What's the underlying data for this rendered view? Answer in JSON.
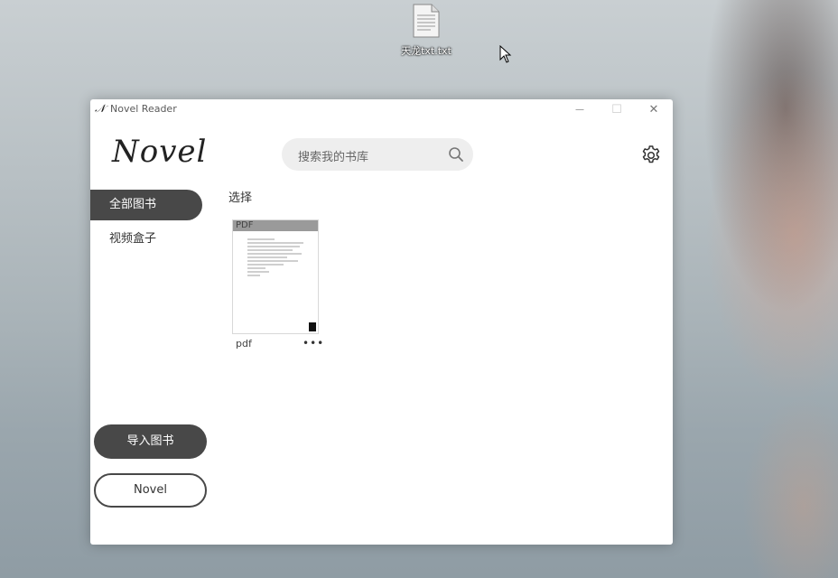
{
  "desktop": {
    "file_label": "天龙txt.txt",
    "file_icon": "text-file-icon",
    "cursor_icon": "arrow-cursor-icon"
  },
  "window": {
    "title": "Novel Reader",
    "app_icon_glyph": "𝒩",
    "minimize_glyph": "—",
    "maximize_glyph": "☐",
    "close_glyph": "✕"
  },
  "header": {
    "logo": "Novel",
    "search_placeholder": "搜索我的书库",
    "settings_icon": "gear-icon"
  },
  "sidebar": {
    "items": [
      {
        "label": "全部图书",
        "active": true
      },
      {
        "label": "视频盒子",
        "active": false
      }
    ],
    "import_button": "导入图书",
    "novel_button": "Novel"
  },
  "main": {
    "select_label": "选择",
    "books": [
      {
        "title": "pdf",
        "cover_badge": "PDF",
        "more": "•••"
      }
    ]
  },
  "colors": {
    "accent_dark": "#484848",
    "window_bg": "#ffffff",
    "search_bg": "#eeeeee"
  }
}
